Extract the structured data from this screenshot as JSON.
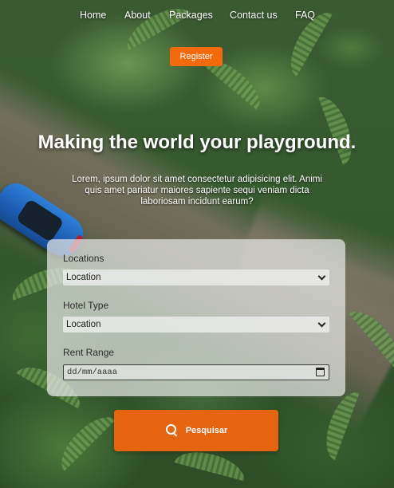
{
  "nav": {
    "items": [
      "Home",
      "About",
      "Packages",
      "Contact us",
      "FAQ"
    ],
    "register_label": "Register"
  },
  "hero": {
    "title": "Making the world your playground.",
    "text": "Lorem, ipsum dolor sit amet consectetur adipisicing elit. Animi quis amet pariatur maiores sapiente sequi veniam dicta laboriosam incidunt earum?"
  },
  "form": {
    "locations_label": "Locations",
    "locations_value": "Location",
    "hotel_type_label": "Hotel Type",
    "hotel_type_value": "Location",
    "rent_range_label": "Rent Range",
    "rent_range_placeholder": "dd/mm/aaaa"
  },
  "search": {
    "label": "Pesquisar",
    "icon": "search-icon"
  },
  "colors": {
    "accent": "#f26a0c",
    "button": "#e4640f"
  }
}
